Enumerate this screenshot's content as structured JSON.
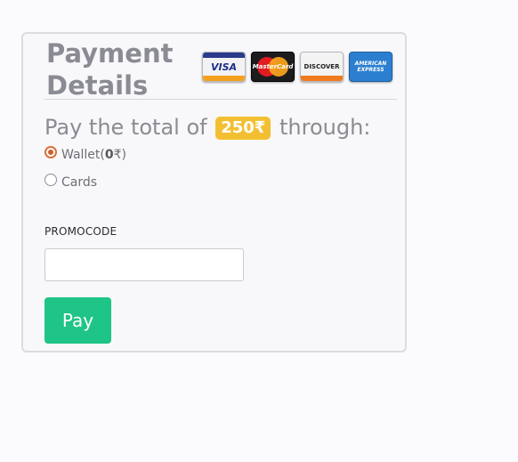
{
  "payment": {
    "title_line1": "Payment",
    "title_line2": "Details",
    "cards": {
      "visa": "VISA",
      "mastercard": "MasterCard",
      "discover": "DISCOVER",
      "amex": "AMERICAN\nEXPRESS"
    },
    "total_prefix": "Pay the total of",
    "total_amount": "250₹",
    "total_suffix": "through:",
    "options": {
      "wallet_label_prefix": "Wallet(",
      "wallet_balance": "0",
      "wallet_label_suffix": "₹)",
      "wallet_selected": true,
      "cards_label": "Cards",
      "cards_selected": false
    },
    "promocode_label": "PROMOCODE",
    "promocode_value": "",
    "pay_button": "Pay"
  },
  "colors": {
    "accent_green": "#1fc586",
    "amount_badge": "#f3bf32",
    "radio_checked": "#d9703c"
  },
  "icons": [
    "visa-card-icon",
    "mastercard-icon",
    "discover-card-icon",
    "amex-card-icon"
  ]
}
